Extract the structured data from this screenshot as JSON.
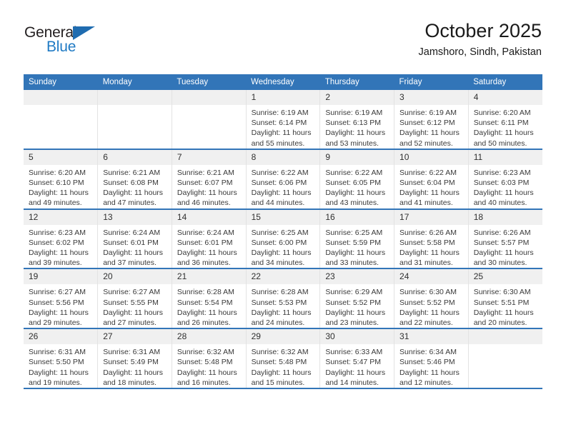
{
  "brand": {
    "name_part1": "General",
    "name_part2": "Blue",
    "triangle_color": "#1f6cb0",
    "blue_color": "#1f7ac4"
  },
  "header": {
    "title": "October 2025",
    "subtitle": "Jamshoro, Sindh, Pakistan",
    "header_bg_color": "#3275b8"
  },
  "weekdays": [
    "Sunday",
    "Monday",
    "Tuesday",
    "Wednesday",
    "Thursday",
    "Friday",
    "Saturday"
  ],
  "weeks": [
    [
      {
        "day": "",
        "empty": true
      },
      {
        "day": "",
        "empty": true
      },
      {
        "day": "",
        "empty": true
      },
      {
        "day": "1",
        "sunrise": "Sunrise: 6:19 AM",
        "sunset": "Sunset: 6:14 PM",
        "daylight": "Daylight: 11 hours and 55 minutes."
      },
      {
        "day": "2",
        "sunrise": "Sunrise: 6:19 AM",
        "sunset": "Sunset: 6:13 PM",
        "daylight": "Daylight: 11 hours and 53 minutes."
      },
      {
        "day": "3",
        "sunrise": "Sunrise: 6:19 AM",
        "sunset": "Sunset: 6:12 PM",
        "daylight": "Daylight: 11 hours and 52 minutes."
      },
      {
        "day": "4",
        "sunrise": "Sunrise: 6:20 AM",
        "sunset": "Sunset: 6:11 PM",
        "daylight": "Daylight: 11 hours and 50 minutes."
      }
    ],
    [
      {
        "day": "5",
        "sunrise": "Sunrise: 6:20 AM",
        "sunset": "Sunset: 6:10 PM",
        "daylight": "Daylight: 11 hours and 49 minutes."
      },
      {
        "day": "6",
        "sunrise": "Sunrise: 6:21 AM",
        "sunset": "Sunset: 6:08 PM",
        "daylight": "Daylight: 11 hours and 47 minutes."
      },
      {
        "day": "7",
        "sunrise": "Sunrise: 6:21 AM",
        "sunset": "Sunset: 6:07 PM",
        "daylight": "Daylight: 11 hours and 46 minutes."
      },
      {
        "day": "8",
        "sunrise": "Sunrise: 6:22 AM",
        "sunset": "Sunset: 6:06 PM",
        "daylight": "Daylight: 11 hours and 44 minutes."
      },
      {
        "day": "9",
        "sunrise": "Sunrise: 6:22 AM",
        "sunset": "Sunset: 6:05 PM",
        "daylight": "Daylight: 11 hours and 43 minutes."
      },
      {
        "day": "10",
        "sunrise": "Sunrise: 6:22 AM",
        "sunset": "Sunset: 6:04 PM",
        "daylight": "Daylight: 11 hours and 41 minutes."
      },
      {
        "day": "11",
        "sunrise": "Sunrise: 6:23 AM",
        "sunset": "Sunset: 6:03 PM",
        "daylight": "Daylight: 11 hours and 40 minutes."
      }
    ],
    [
      {
        "day": "12",
        "sunrise": "Sunrise: 6:23 AM",
        "sunset": "Sunset: 6:02 PM",
        "daylight": "Daylight: 11 hours and 39 minutes."
      },
      {
        "day": "13",
        "sunrise": "Sunrise: 6:24 AM",
        "sunset": "Sunset: 6:01 PM",
        "daylight": "Daylight: 11 hours and 37 minutes."
      },
      {
        "day": "14",
        "sunrise": "Sunrise: 6:24 AM",
        "sunset": "Sunset: 6:01 PM",
        "daylight": "Daylight: 11 hours and 36 minutes."
      },
      {
        "day": "15",
        "sunrise": "Sunrise: 6:25 AM",
        "sunset": "Sunset: 6:00 PM",
        "daylight": "Daylight: 11 hours and 34 minutes."
      },
      {
        "day": "16",
        "sunrise": "Sunrise: 6:25 AM",
        "sunset": "Sunset: 5:59 PM",
        "daylight": "Daylight: 11 hours and 33 minutes."
      },
      {
        "day": "17",
        "sunrise": "Sunrise: 6:26 AM",
        "sunset": "Sunset: 5:58 PM",
        "daylight": "Daylight: 11 hours and 31 minutes."
      },
      {
        "day": "18",
        "sunrise": "Sunrise: 6:26 AM",
        "sunset": "Sunset: 5:57 PM",
        "daylight": "Daylight: 11 hours and 30 minutes."
      }
    ],
    [
      {
        "day": "19",
        "sunrise": "Sunrise: 6:27 AM",
        "sunset": "Sunset: 5:56 PM",
        "daylight": "Daylight: 11 hours and 29 minutes."
      },
      {
        "day": "20",
        "sunrise": "Sunrise: 6:27 AM",
        "sunset": "Sunset: 5:55 PM",
        "daylight": "Daylight: 11 hours and 27 minutes."
      },
      {
        "day": "21",
        "sunrise": "Sunrise: 6:28 AM",
        "sunset": "Sunset: 5:54 PM",
        "daylight": "Daylight: 11 hours and 26 minutes."
      },
      {
        "day": "22",
        "sunrise": "Sunrise: 6:28 AM",
        "sunset": "Sunset: 5:53 PM",
        "daylight": "Daylight: 11 hours and 24 minutes."
      },
      {
        "day": "23",
        "sunrise": "Sunrise: 6:29 AM",
        "sunset": "Sunset: 5:52 PM",
        "daylight": "Daylight: 11 hours and 23 minutes."
      },
      {
        "day": "24",
        "sunrise": "Sunrise: 6:30 AM",
        "sunset": "Sunset: 5:52 PM",
        "daylight": "Daylight: 11 hours and 22 minutes."
      },
      {
        "day": "25",
        "sunrise": "Sunrise: 6:30 AM",
        "sunset": "Sunset: 5:51 PM",
        "daylight": "Daylight: 11 hours and 20 minutes."
      }
    ],
    [
      {
        "day": "26",
        "sunrise": "Sunrise: 6:31 AM",
        "sunset": "Sunset: 5:50 PM",
        "daylight": "Daylight: 11 hours and 19 minutes."
      },
      {
        "day": "27",
        "sunrise": "Sunrise: 6:31 AM",
        "sunset": "Sunset: 5:49 PM",
        "daylight": "Daylight: 11 hours and 18 minutes."
      },
      {
        "day": "28",
        "sunrise": "Sunrise: 6:32 AM",
        "sunset": "Sunset: 5:48 PM",
        "daylight": "Daylight: 11 hours and 16 minutes."
      },
      {
        "day": "29",
        "sunrise": "Sunrise: 6:32 AM",
        "sunset": "Sunset: 5:48 PM",
        "daylight": "Daylight: 11 hours and 15 minutes."
      },
      {
        "day": "30",
        "sunrise": "Sunrise: 6:33 AM",
        "sunset": "Sunset: 5:47 PM",
        "daylight": "Daylight: 11 hours and 14 minutes."
      },
      {
        "day": "31",
        "sunrise": "Sunrise: 6:34 AM",
        "sunset": "Sunset: 5:46 PM",
        "daylight": "Daylight: 11 hours and 12 minutes."
      },
      {
        "day": "",
        "empty": true
      }
    ]
  ]
}
